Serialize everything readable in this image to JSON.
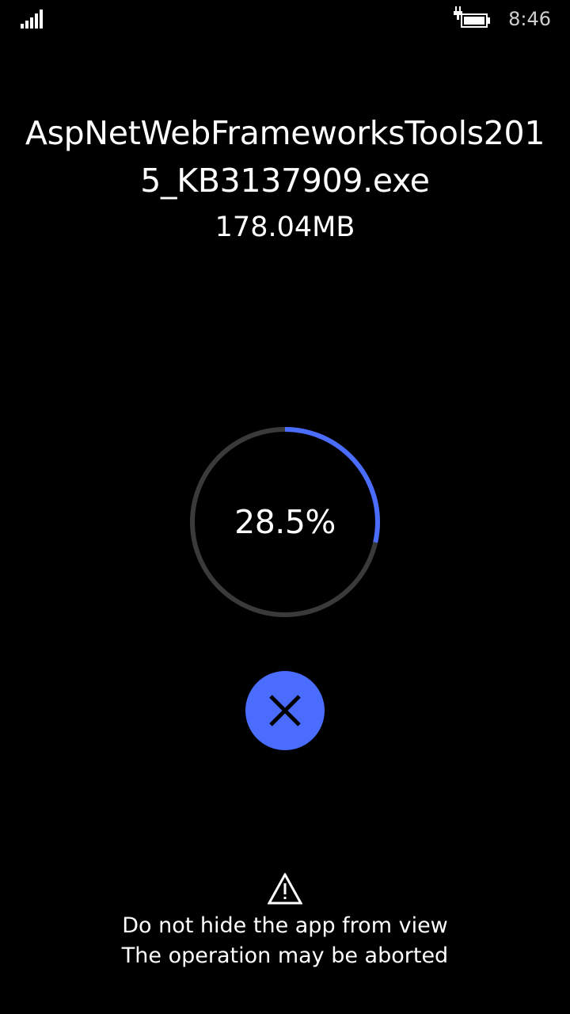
{
  "status_bar": {
    "time": "8:46",
    "signal_icon": "signal-strength-icon",
    "battery_icon": "battery-charging-icon"
  },
  "download": {
    "file_name": "AspNetWebFrameworksTools2015_KB3137909.exe",
    "file_size": "178.04MB",
    "progress_fraction": 0.285,
    "progress_text": "28.5%"
  },
  "cancel_button": {
    "icon": "close-icon"
  },
  "warning": {
    "icon": "warning-icon",
    "line1": "Do not hide the app from view",
    "line2": "The operation may be aborted"
  },
  "colors": {
    "accent": "#4a6cff",
    "ring_track": "#3a3a3a",
    "background": "#000000",
    "text": "#ffffff"
  }
}
